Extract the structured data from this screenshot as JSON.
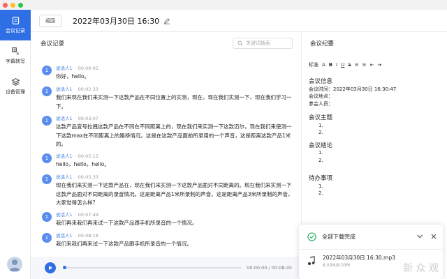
{
  "window": {
    "dot_colors": [
      "#ff5f57",
      "#ffbd2e",
      "#28c840"
    ]
  },
  "sidebar": {
    "items": [
      {
        "label": "会议记录",
        "icon": "document-icon",
        "active": true
      },
      {
        "label": "字幕转写",
        "icon": "translate-icon",
        "active": false
      },
      {
        "label": "设备管理",
        "icon": "layers-icon",
        "active": false
      }
    ]
  },
  "header": {
    "back_label": "返回",
    "title": "2022年03月30日 16:30"
  },
  "transcript": {
    "heading": "会议记录",
    "search_placeholder": "关键词搜索",
    "messages": [
      {
        "avatar": "1",
        "speaker": "说话人1",
        "time": "00:00:05",
        "text": "你好，hello。"
      },
      {
        "avatar": "1",
        "speaker": "说话人1",
        "time": "00:02:33",
        "text": "我们来现在我们来实测一下这款产品在不同位置上的实测，现在，现在我们实测一下，现在我们学习一下。"
      },
      {
        "avatar": "1",
        "speaker": "说话人1",
        "time": "00:03:07",
        "text": "这款产品宜号拉拽这款产品在不同在不同距离上的，现在我们来实测一下这款迈尔，现在我们来使测一下这款max在不同距离上的路移情况。这是在这款产品面前所录用的一个声音，这是距离这款产品1米的。"
      },
      {
        "avatar": "1",
        "speaker": "说话人1",
        "time": "00:05:15",
        "text": "hello，hello，hello。"
      },
      {
        "avatar": "1",
        "speaker": "说话人1",
        "time": "00:05:33",
        "text": "现在我们来实测一下这款产品在，现在我们来实测一下这款产品面对不同距离的。现在我们来实测一下这款产品面对不同距离的录音情况。这是距离产品1米所录制的声音。这是距离产品3米所录制的声音，大家觉得怎么样？"
      },
      {
        "avatar": "1",
        "speaker": "说话人1",
        "time": "00:07:49",
        "text": "我们再来我们再来试一下这款产品跟手机所录音的一个情况。"
      },
      {
        "avatar": "1",
        "speaker": "说话人1",
        "time": "00:08:18",
        "text": "我们来我们再来试一下这款产品跟手机所录音的一个情况。"
      }
    ]
  },
  "player": {
    "time": "00:00:00 / 00:08:45",
    "progress": 0.0
  },
  "summary": {
    "heading": "会议纪要",
    "toolbar": [
      "标准",
      "A",
      "B",
      "I",
      "U",
      "S",
      "≡",
      "≡",
      "⇤",
      "⇥"
    ],
    "info_title": "会议信息",
    "info_time": "会议时间：2022年03月30日 16:30:47",
    "info_place": "会议地点：",
    "info_people": "参会人员：",
    "topic_title": "会议主题",
    "conclusion_title": "会议结论",
    "todo_title": "待办事项",
    "bullet1": "1.",
    "bullet2": "2."
  },
  "toast": {
    "title": "全部下载完成",
    "file_name": "2022年03月30日 16:30.mp3",
    "file_size": "8.03M/8.03M",
    "accent": "#2fb36b"
  },
  "watermark": "新 众 观"
}
